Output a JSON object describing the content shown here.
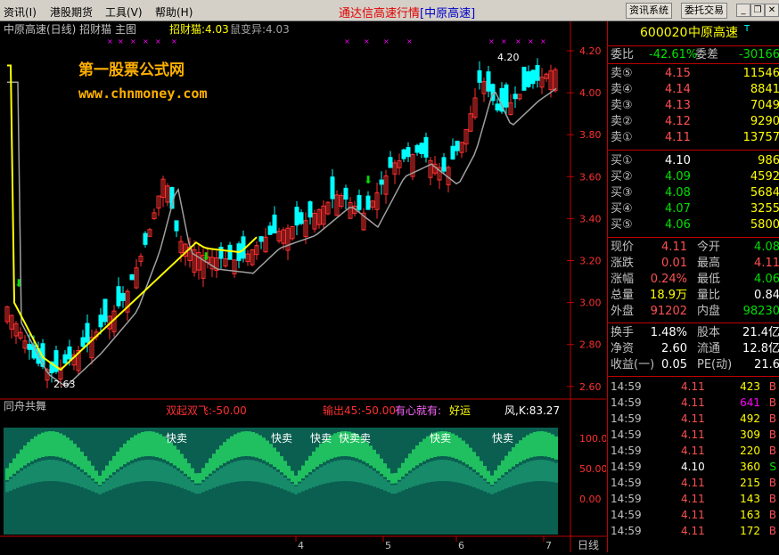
{
  "menu": {
    "items": [
      "资讯(I)",
      "港股期货",
      "工具(V)",
      "帮助(H)"
    ],
    "title_main": "通达信高速行情",
    "title_sub": "[中原高速]",
    "btn_info": "资讯系统",
    "btn_trade": "委托交易"
  },
  "chart": {
    "header": "中原高速(日线) 招财猫 主图",
    "indicator_label": "招财猫:4.03",
    "indicator2_label": "鼠变异:4.03",
    "watermark_cn": "第一股票公式网",
    "watermark_url": "www.chnmoney.com",
    "high_label": "4.20",
    "low_label": "2.63",
    "yaxis": [
      "4.20",
      "4.00",
      "3.80",
      "3.60",
      "3.40",
      "3.20",
      "3.00",
      "2.80",
      "2.60"
    ],
    "sub_name": "同舟共舞",
    "sub_label1": "双起双飞:-50.00",
    "sub_label2": "输出45:-50.00",
    "sub_label3": "有心就有:",
    "sub_label4": "好运",
    "sub_label5": "风,K:83.27",
    "sub_yaxis": [
      "100.0",
      "50.00",
      "0.00"
    ],
    "sub_marks": [
      "快卖",
      "快卖",
      "快卖",
      "快卖卖",
      "快卖",
      "快卖"
    ],
    "xaxis": [
      "4",
      "5",
      "6",
      "7"
    ],
    "period": "日线",
    "colors": {
      "up": "#ff3030",
      "down": "#00ffff",
      "ma_grey": "#a0a0a0",
      "ma_yellow": "#ffff00",
      "green": "#00c060"
    }
  },
  "stock": {
    "code": "600020",
    "name": "中原高速",
    "mark": "T"
  },
  "quote": {
    "committee_ratio_label": "委比",
    "committee_ratio": "-42.61%",
    "committee_diff_label": "委差",
    "committee_diff": "-30166",
    "sells": [
      {
        "label": "卖⑤",
        "price": "4.15",
        "vol": "11546"
      },
      {
        "label": "卖④",
        "price": "4.14",
        "vol": "8841"
      },
      {
        "label": "卖③",
        "price": "4.13",
        "vol": "7049"
      },
      {
        "label": "卖②",
        "price": "4.12",
        "vol": "9290"
      },
      {
        "label": "卖①",
        "price": "4.11",
        "vol": "13757"
      }
    ],
    "buys": [
      {
        "label": "买①",
        "price": "4.10",
        "vol": "986"
      },
      {
        "label": "买②",
        "price": "4.09",
        "vol": "4592"
      },
      {
        "label": "买③",
        "price": "4.08",
        "vol": "5684"
      },
      {
        "label": "买④",
        "price": "4.07",
        "vol": "3255"
      },
      {
        "label": "买⑤",
        "price": "4.06",
        "vol": "5800"
      }
    ],
    "stats": [
      {
        "l1": "现价",
        "v1": "4.11",
        "l2": "今开",
        "v2": "4.08"
      },
      {
        "l1": "涨跌",
        "v1": "0.01",
        "l2": "最高",
        "v2": "4.11"
      },
      {
        "l1": "涨幅",
        "v1": "0.24%",
        "l2": "最低",
        "v2": "4.06"
      },
      {
        "l1": "总量",
        "v1": "18.9万",
        "l2": "量比",
        "v2": "0.84"
      },
      {
        "l1": "外盘",
        "v1": "91202",
        "l2": "内盘",
        "v2": "98230"
      }
    ],
    "fund": [
      {
        "l1": "换手",
        "v1": "1.48%",
        "l2": "股本",
        "v2": "21.4亿"
      },
      {
        "l1": "净资",
        "v1": "2.60",
        "l2": "流通",
        "v2": "12.8亿"
      },
      {
        "l1": "收益(一)",
        "v1": "0.05",
        "l2": "PE(动)",
        "v2": "21.6"
      }
    ],
    "ticks": [
      {
        "t": "14:59",
        "p": "4.11",
        "v": "423",
        "d": "B"
      },
      {
        "t": "14:59",
        "p": "4.11",
        "v": "641",
        "d": "B"
      },
      {
        "t": "14:59",
        "p": "4.11",
        "v": "492",
        "d": "B"
      },
      {
        "t": "14:59",
        "p": "4.11",
        "v": "309",
        "d": "B"
      },
      {
        "t": "14:59",
        "p": "4.11",
        "v": "220",
        "d": "B"
      },
      {
        "t": "14:59",
        "p": "4.10",
        "v": "360",
        "d": "S"
      },
      {
        "t": "14:59",
        "p": "4.11",
        "v": "215",
        "d": "B"
      },
      {
        "t": "14:59",
        "p": "4.11",
        "v": "143",
        "d": "B"
      },
      {
        "t": "14:59",
        "p": "4.11",
        "v": "163",
        "d": "B"
      },
      {
        "t": "14:59",
        "p": "4.11",
        "v": "172",
        "d": "B"
      }
    ]
  }
}
